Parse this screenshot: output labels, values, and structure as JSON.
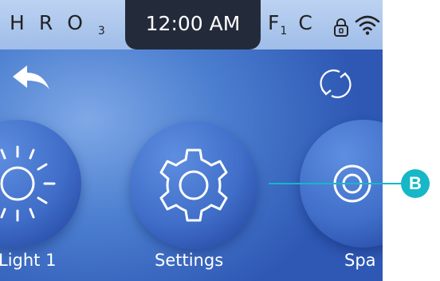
{
  "status_bar": {
    "indicators_left": [
      "H",
      "R"
    ],
    "ozone_label": "O",
    "ozone_sub": "3",
    "time": "12:00 AM",
    "filter_label": "F",
    "filter_sub": "1",
    "temp_unit": "C",
    "lock_icon": "lock-icon",
    "wifi_icon": "wifi-icon"
  },
  "toolbar": {
    "back_icon": "back-arrow-icon",
    "refresh_icon": "refresh-icon"
  },
  "menu": {
    "items": [
      {
        "label": "Light 1",
        "icon": "light-icon"
      },
      {
        "label": "Settings",
        "icon": "gear-icon"
      },
      {
        "label": "Spa",
        "icon": "spa-icon"
      }
    ]
  },
  "callout": {
    "label": "B",
    "color": "#16b7c6"
  },
  "colors": {
    "accent": "#16b7c6",
    "status_bar": "#a9c4ec",
    "time_pill": "#232b3a"
  }
}
